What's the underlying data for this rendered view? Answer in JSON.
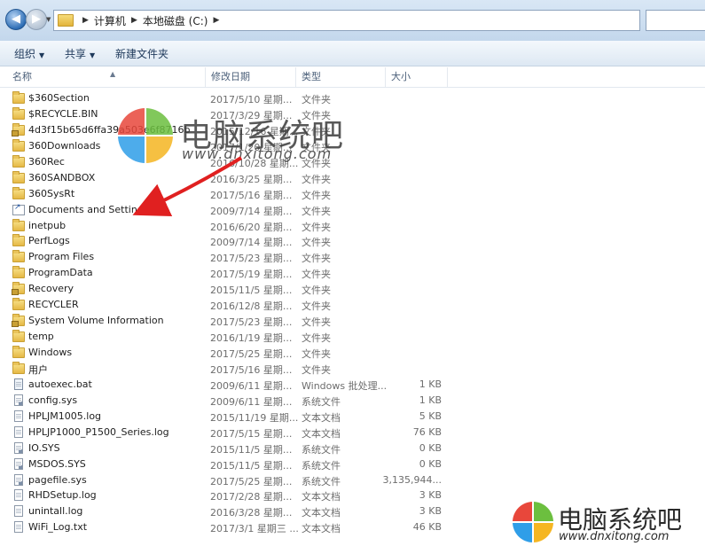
{
  "address": {
    "path": [
      "计算机",
      "本地磁盘 (C:)"
    ]
  },
  "toolbar": {
    "organize": "组织",
    "share": "共享",
    "new_folder": "新建文件夹"
  },
  "columns": {
    "name": "名称",
    "date": "修改日期",
    "type": "类型",
    "size": "大小"
  },
  "files": [
    {
      "name": "$360Section",
      "date": "2017/5/10 星期...",
      "type": "文件夹",
      "size": "",
      "icon": "folder-icon"
    },
    {
      "name": "$RECYCLE.BIN",
      "date": "2017/3/29 星期...",
      "type": "文件夹",
      "size": "",
      "icon": "folder-icon"
    },
    {
      "name": "4d3f15b65d6ffa39a503e6f8716b",
      "date": "2015/12/16 星期...",
      "type": "文件夹",
      "size": "",
      "icon": "locked-folder-icon"
    },
    {
      "name": "360Downloads",
      "date": "2017/1/20 星期...",
      "type": "文件夹",
      "size": "",
      "icon": "folder-icon"
    },
    {
      "name": "360Rec",
      "date": "2016/10/28 星期...",
      "type": "文件夹",
      "size": "",
      "icon": "folder-icon"
    },
    {
      "name": "360SANDBOX",
      "date": "2016/3/25 星期...",
      "type": "文件夹",
      "size": "",
      "icon": "folder-icon"
    },
    {
      "name": "360SysRt",
      "date": "2017/5/16 星期...",
      "type": "文件夹",
      "size": "",
      "icon": "folder-icon"
    },
    {
      "name": "Documents and Settings",
      "date": "2009/7/14 星期...",
      "type": "文件夹",
      "size": "",
      "icon": "shortcut-folder-icon"
    },
    {
      "name": "inetpub",
      "date": "2016/6/20 星期...",
      "type": "文件夹",
      "size": "",
      "icon": "folder-icon"
    },
    {
      "name": "PerfLogs",
      "date": "2009/7/14 星期...",
      "type": "文件夹",
      "size": "",
      "icon": "folder-icon"
    },
    {
      "name": "Program Files",
      "date": "2017/5/23 星期...",
      "type": "文件夹",
      "size": "",
      "icon": "folder-icon"
    },
    {
      "name": "ProgramData",
      "date": "2017/5/19 星期...",
      "type": "文件夹",
      "size": "",
      "icon": "folder-icon"
    },
    {
      "name": "Recovery",
      "date": "2015/11/5 星期...",
      "type": "文件夹",
      "size": "",
      "icon": "locked-folder-icon"
    },
    {
      "name": "RECYCLER",
      "date": "2016/12/8 星期...",
      "type": "文件夹",
      "size": "",
      "icon": "folder-icon"
    },
    {
      "name": "System Volume Information",
      "date": "2017/5/23 星期...",
      "type": "文件夹",
      "size": "",
      "icon": "locked-folder-icon"
    },
    {
      "name": "temp",
      "date": "2016/1/19 星期...",
      "type": "文件夹",
      "size": "",
      "icon": "folder-icon"
    },
    {
      "name": "Windows",
      "date": "2017/5/25 星期...",
      "type": "文件夹",
      "size": "",
      "icon": "folder-icon"
    },
    {
      "name": "用户",
      "date": "2017/5/16 星期...",
      "type": "文件夹",
      "size": "",
      "icon": "folder-icon"
    },
    {
      "name": "autoexec.bat",
      "date": "2009/6/11 星期...",
      "type": "Windows 批处理...",
      "size": "1 KB",
      "icon": "batch-file-icon"
    },
    {
      "name": "config.sys",
      "date": "2009/6/11 星期...",
      "type": "系统文件",
      "size": "1 KB",
      "icon": "system-file-icon"
    },
    {
      "name": "HPLJM1005.log",
      "date": "2015/11/19 星期...",
      "type": "文本文档",
      "size": "5 KB",
      "icon": "text-file-icon"
    },
    {
      "name": "HPLJP1000_P1500_Series.log",
      "date": "2017/5/15 星期...",
      "type": "文本文档",
      "size": "76 KB",
      "icon": "text-file-icon"
    },
    {
      "name": "IO.SYS",
      "date": "2015/11/5 星期...",
      "type": "系统文件",
      "size": "0 KB",
      "icon": "system-file-icon"
    },
    {
      "name": "MSDOS.SYS",
      "date": "2015/11/5 星期...",
      "type": "系统文件",
      "size": "0 KB",
      "icon": "system-file-icon"
    },
    {
      "name": "pagefile.sys",
      "date": "2017/5/25 星期...",
      "type": "系统文件",
      "size": "3,135,944...",
      "icon": "system-file-icon"
    },
    {
      "name": "RHDSetup.log",
      "date": "2017/2/28 星期...",
      "type": "文本文档",
      "size": "3 KB",
      "icon": "text-file-icon"
    },
    {
      "name": "unintall.log",
      "date": "2016/3/28 星期...",
      "type": "文本文档",
      "size": "3 KB",
      "icon": "text-file-icon"
    },
    {
      "name": "WiFi_Log.txt",
      "date": "2017/3/1 星期三 ...",
      "type": "文本文档",
      "size": "46 KB",
      "icon": "text-file-icon"
    }
  ],
  "watermark": {
    "title": "电脑系统吧",
    "url": "www.dnxitong.com"
  },
  "colors": {
    "logo_red": "#e8473b",
    "logo_green": "#6cbf3f",
    "logo_blue": "#2f9ee8",
    "logo_yellow": "#f5b622",
    "arrow_red": "#e02020"
  }
}
